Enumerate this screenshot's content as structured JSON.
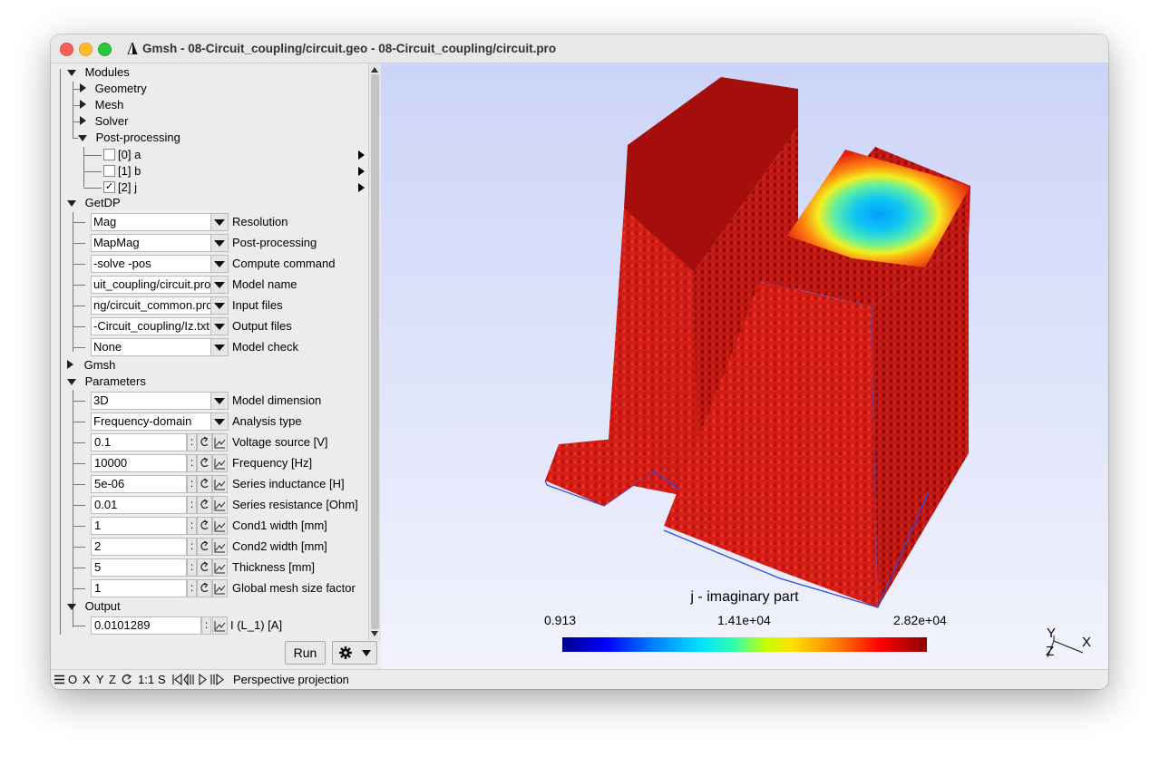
{
  "window": {
    "title": "Gmsh - 08-Circuit_coupling/circuit.geo - 08-Circuit_coupling/circuit.pro"
  },
  "tree": {
    "modules": "Modules",
    "geometry": "Geometry",
    "mesh": "Mesh",
    "solver": "Solver",
    "postprocessing": "Post-processing",
    "views": [
      {
        "label": "[0] a",
        "checked": false,
        "mark": ""
      },
      {
        "label": "[1] b",
        "checked": false,
        "mark": ""
      },
      {
        "label": "[2] j",
        "checked": true,
        "mark": "✓"
      }
    ],
    "getdp": "GetDP",
    "getdp_fields": [
      {
        "value": "Mag",
        "label": "Resolution"
      },
      {
        "value": "MapMag",
        "label": "Post-processing"
      },
      {
        "value": "-solve -pos",
        "label": "Compute command"
      },
      {
        "value": "uit_coupling/circuit.pro",
        "label": "Model name"
      },
      {
        "value": "ng/circuit_common.pro",
        "label": "Input files"
      },
      {
        "value": "-Circuit_coupling/Iz.txt",
        "label": "Output files"
      },
      {
        "value": "None",
        "label": "Model check"
      }
    ],
    "gmsh": "Gmsh",
    "parameters": "Parameters",
    "param_choices": [
      {
        "value": "3D",
        "label": "Model dimension"
      },
      {
        "value": "Frequency-domain",
        "label": "Analysis type"
      }
    ],
    "param_numbers": [
      {
        "value": "0.1",
        "label": "Voltage source [V]"
      },
      {
        "value": "10000",
        "label": "Frequency [Hz]"
      },
      {
        "value": "5e-06",
        "label": "Series inductance [H]"
      },
      {
        "value": "0.01",
        "label": "Series resistance [Ohm]"
      },
      {
        "value": "1",
        "label": "Cond1 width [mm]"
      },
      {
        "value": "2",
        "label": "Cond2 width [mm]"
      },
      {
        "value": "5",
        "label": "Thickness [mm]"
      },
      {
        "value": "1",
        "label": "Global mesh size factor"
      }
    ],
    "output": "Output",
    "output_fields": [
      {
        "value": "0.0101289",
        "label": "I (L_1) [A]"
      }
    ],
    "colon": ":"
  },
  "buttons": {
    "run": "Run"
  },
  "viewport": {
    "colorbar_title": "j - imaginary part",
    "colorbar_min": "0.913",
    "colorbar_mid": "1.41e+04",
    "colorbar_max": "2.82e+04",
    "axis_y": "Y",
    "axis_x": "X",
    "axis_z": "Z"
  },
  "statusbar": {
    "items": [
      "O",
      "X",
      "Y",
      "Z",
      "1:1",
      "S"
    ],
    "projection": "Perspective projection"
  },
  "colors": {
    "mesh_red": "#d8201a",
    "mesh_dark_red": "#a50f0b",
    "mesh_edge_blue": "#3048e0"
  }
}
